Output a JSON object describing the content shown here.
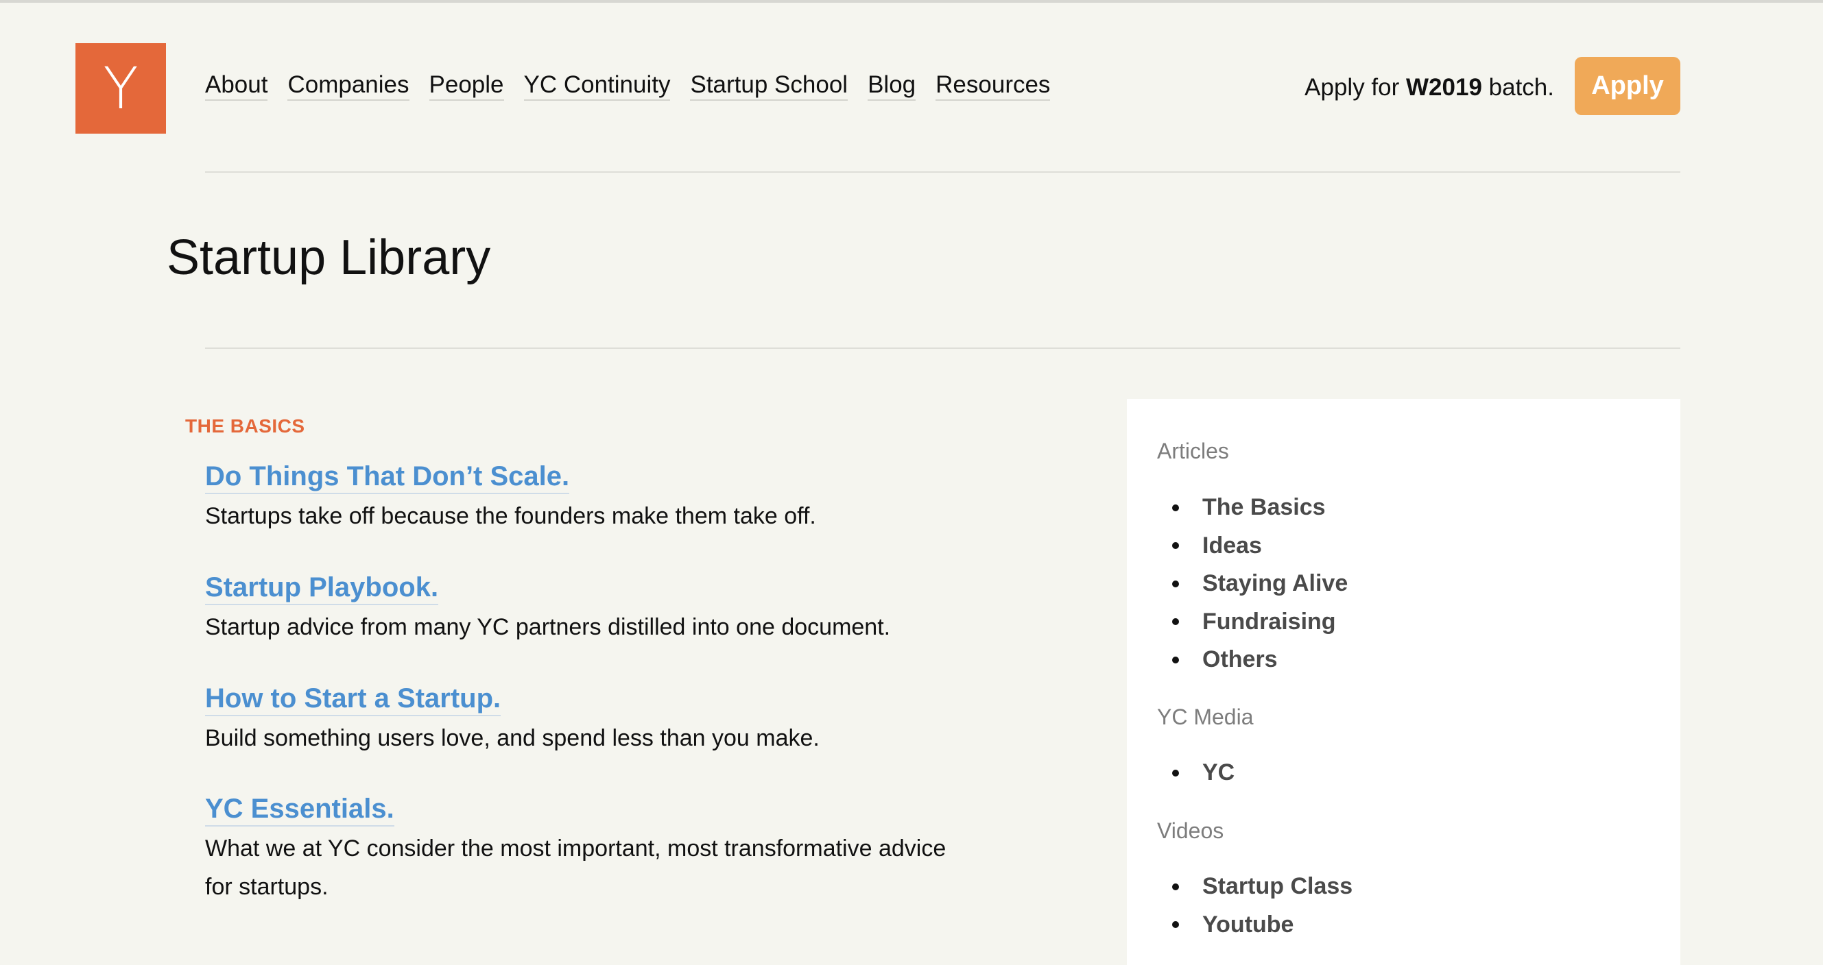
{
  "logo": {
    "letter": "Y"
  },
  "nav": {
    "items": [
      "About",
      "Companies",
      "People",
      "YC Continuity",
      "Startup School",
      "Blog",
      "Resources"
    ]
  },
  "apply": {
    "prefix": "Apply for ",
    "batch": "W2019",
    "suffix": " batch.",
    "button_label": "Apply"
  },
  "page": {
    "title": "Startup Library"
  },
  "section": {
    "label": "THE BASICS"
  },
  "articles": [
    {
      "title": "Do Things That Don’t Scale.",
      "desc": "Startups take off because the founders make them take off."
    },
    {
      "title": "Startup Playbook.",
      "desc": "Startup advice from many YC partners distilled into one document."
    },
    {
      "title": "How to Start a Startup.",
      "desc": "Build something users love, and spend less than you make."
    },
    {
      "title": "YC Essentials.",
      "desc_line1": "What we at YC consider the most important, most transformative advice",
      "desc_line2": "for startups."
    }
  ],
  "sidebar": {
    "articles_heading": "Articles",
    "articles": [
      "The Basics",
      "Ideas",
      "Staying Alive",
      "Fundraising",
      "Others"
    ],
    "media_heading": "YC Media",
    "media": [
      "YC"
    ],
    "videos_heading": "Videos",
    "videos": [
      "Startup Class",
      "Youtube"
    ]
  },
  "colors": {
    "brand": "#e4683a",
    "apply_button": "#f0a958",
    "link": "#4b8fd0",
    "background": "#f5f5ef"
  }
}
